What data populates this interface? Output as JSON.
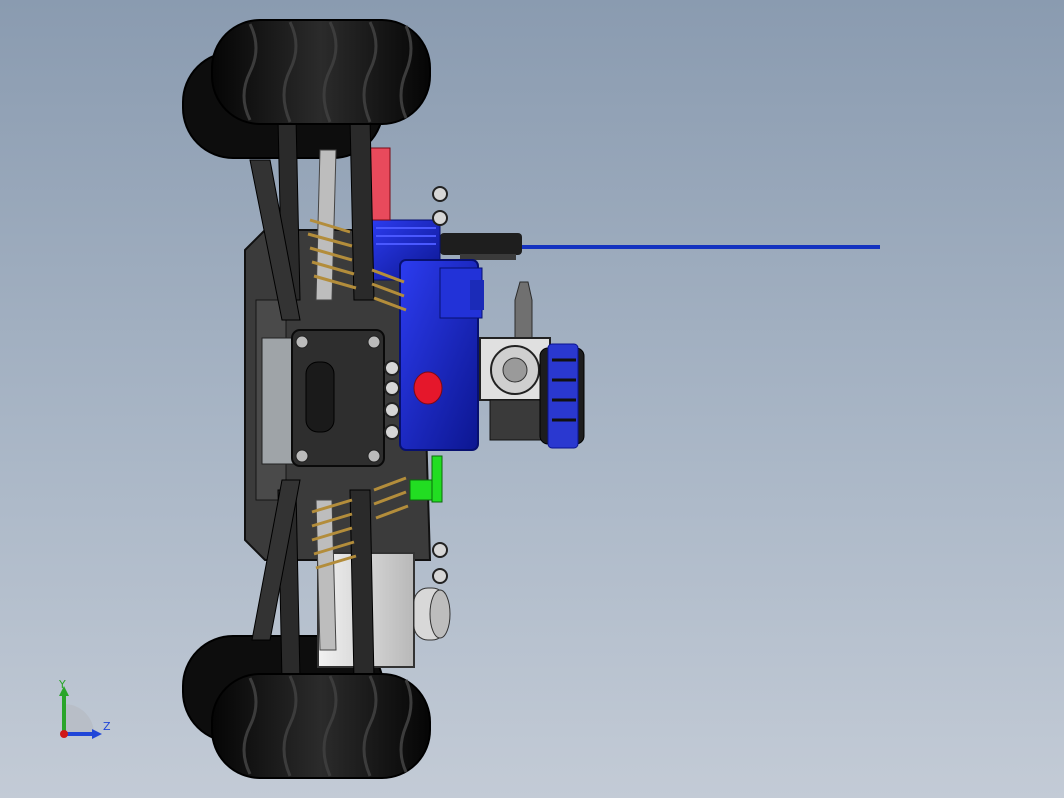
{
  "viewport": {
    "background_top": "#8a9bb0",
    "background_bottom": "#c3cbd6"
  },
  "model": {
    "colors": {
      "tire": "#161616",
      "chassis": "#2a2a2a",
      "engine_blue": "#1a28c8",
      "antenna_blue": "#1432c0",
      "spring_gold": "#b38d3b",
      "red_part": "#e5172b",
      "green_part": "#22dd22",
      "silver": "#d8d8d8",
      "filter_blue": "#2a38d0"
    }
  },
  "triad": {
    "y_label": "Y",
    "z_label": "Z",
    "y_color": "#2aa52a",
    "z_color": "#2046d8",
    "origin_color": "#d01818"
  }
}
